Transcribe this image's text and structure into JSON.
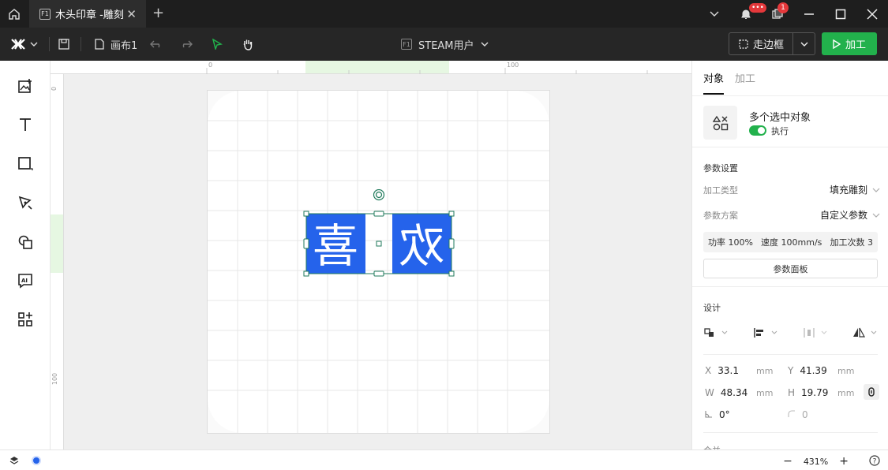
{
  "titlebar": {
    "tab_title": "木头印章 -雕刻",
    "file_icon_label": "F1",
    "notification_badge": "•••",
    "messages_badge": "1",
    "icons": [
      "home-icon",
      "close-tab-icon",
      "add-tab-icon",
      "chevron-down-icon",
      "bell-icon",
      "messages-icon",
      "minimize-icon",
      "maximize-icon",
      "close-window-icon"
    ]
  },
  "toolbar": {
    "canvas_name": "画布1",
    "user_file_icon_label": "F1",
    "user_label": "STEAM用户",
    "frame_button_label": "走边框",
    "process_button_label": "加工",
    "icons": [
      "logo-icon",
      "save-icon",
      "file-icon",
      "undo-icon",
      "redo-icon",
      "select-icon",
      "hand-icon"
    ]
  },
  "leftrail": {
    "items": [
      "image-add-icon",
      "text-icon",
      "shape-icon",
      "pen-icon",
      "boolean-icon",
      "ai-icon",
      "apps-icon"
    ]
  },
  "rulers": {
    "top_labels": [
      "0",
      "100"
    ],
    "left_labels": [
      "0",
      "100"
    ]
  },
  "canvas": {
    "glyph_left": "喜",
    "glyph_right": "欢"
  },
  "rpanel": {
    "tab_object": "对象",
    "tab_process": "加工",
    "object_title": "多个选中对象",
    "execute_label": "执行",
    "params_title": "参数设置",
    "process_type_label": "加工类型",
    "process_type_value": "填充雕刻",
    "scheme_label": "参数方案",
    "scheme_value": "自定义参数",
    "power": "功率 100%",
    "speed": "速度 100mm/s",
    "passes": "加工次数 3",
    "params_panel_button": "参数面板",
    "design_title": "设计",
    "x_label": "X",
    "x_value": "33.1",
    "y_label": "Y",
    "y_value": "41.39",
    "w_label": "W",
    "w_value": "48.34",
    "h_label": "H",
    "h_value": "19.79",
    "unit": "mm",
    "angle_value": "0°",
    "corner_value": "0",
    "merge_label": "合并"
  },
  "status": {
    "zoom": "431%"
  },
  "colors": {
    "accent_green": "#22b14c",
    "selection_blue": "#2563eb",
    "handle_green": "#1f7a5b"
  }
}
